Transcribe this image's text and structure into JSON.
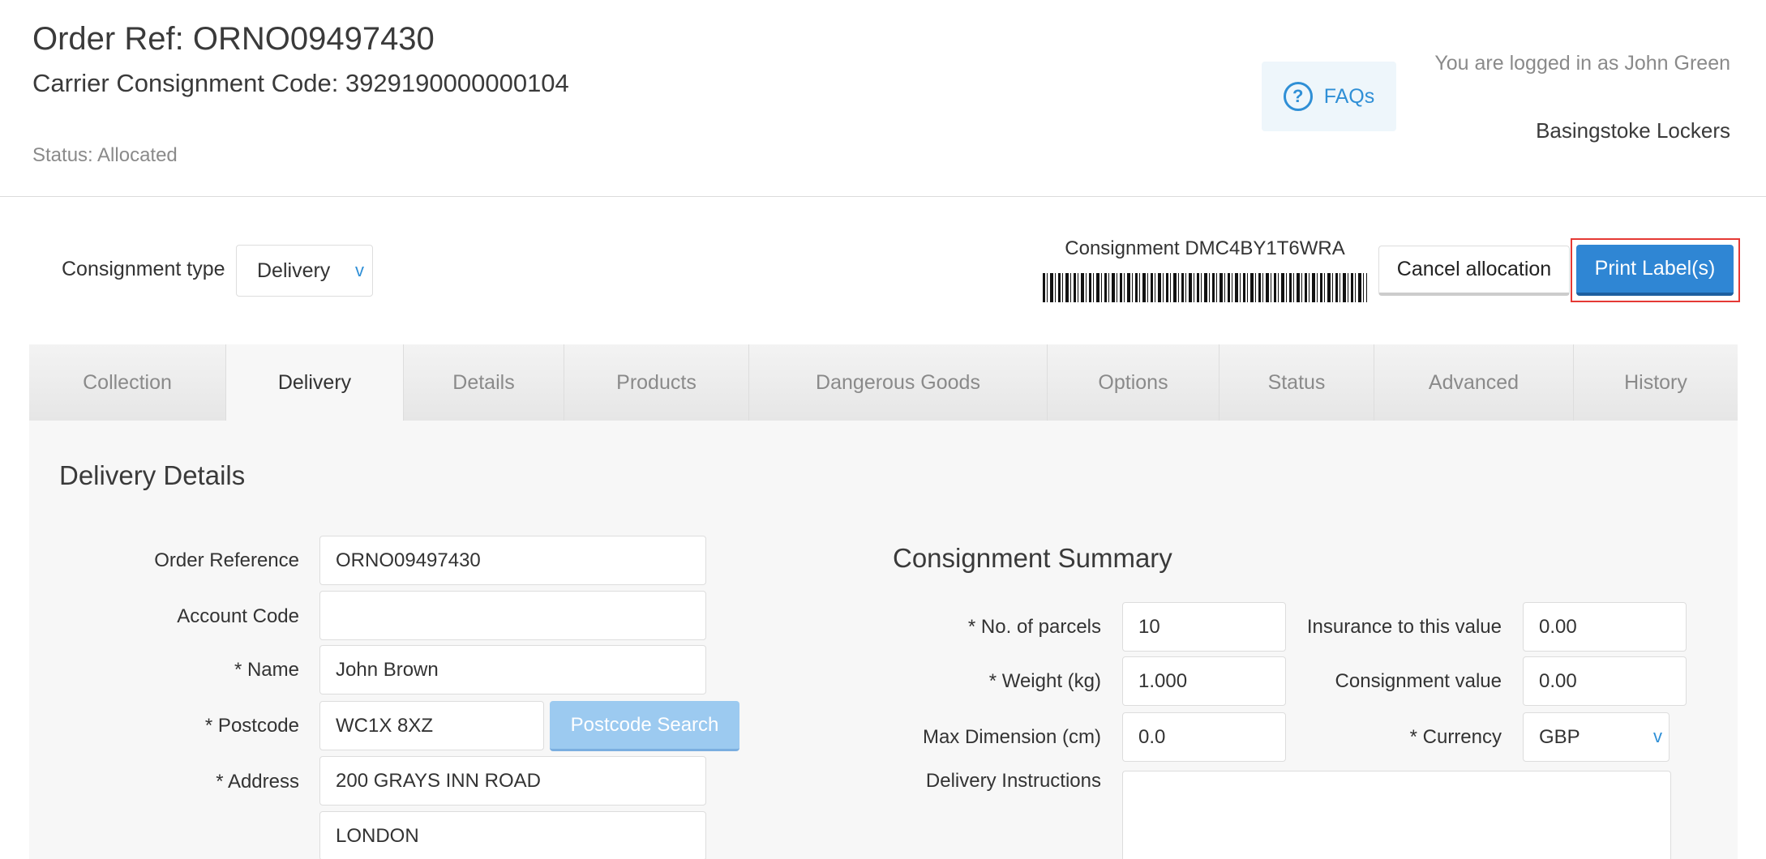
{
  "header": {
    "order_ref": "Order Ref: ORNO09497430",
    "carrier_code": "Carrier Consignment Code: 3929190000000104",
    "status": "Status: Allocated",
    "faq_label": "FAQs",
    "faq_icon": "question-circle-icon",
    "login_text": "You are logged in as John Green",
    "site_name": "Basingstoke Lockers"
  },
  "toolbar": {
    "consignment_type_label": "Consignment type",
    "consignment_type_value": "Delivery",
    "consignment_id": "Consignment DMC4BY1T6WRA",
    "cancel_label": "Cancel allocation",
    "print_label": "Print Label(s)"
  },
  "tabs": [
    {
      "label": "Collection"
    },
    {
      "label": "Delivery"
    },
    {
      "label": "Details"
    },
    {
      "label": "Products"
    },
    {
      "label": "Dangerous Goods"
    },
    {
      "label": "Options"
    },
    {
      "label": "Status"
    },
    {
      "label": "Advanced"
    },
    {
      "label": "History"
    }
  ],
  "active_tab": "Delivery",
  "delivery": {
    "title": "Delivery Details",
    "fields": {
      "order_reference": {
        "label": "Order Reference",
        "value": "ORNO09497430"
      },
      "account_code": {
        "label": "Account Code",
        "value": ""
      },
      "name": {
        "label": "* Name",
        "value": "John Brown"
      },
      "postcode": {
        "label": "* Postcode",
        "value": "WC1X 8XZ"
      },
      "address": {
        "label": "* Address",
        "line1": "200 GRAYS INN ROAD",
        "line2": "LONDON"
      }
    },
    "postcode_search_label": "Postcode Search"
  },
  "summary": {
    "title": "Consignment Summary",
    "parcels": {
      "label": "* No. of parcels",
      "value": "10"
    },
    "weight": {
      "label": "* Weight (kg)",
      "value": "1.000"
    },
    "max_dim": {
      "label": "Max Dimension (cm)",
      "value": "0.0"
    },
    "insurance": {
      "label": "Insurance to this value",
      "value": "0.00"
    },
    "cons_value": {
      "label": "Consignment value",
      "value": "0.00"
    },
    "currency": {
      "label": "* Currency",
      "value": "GBP"
    },
    "instructions": {
      "label": "Delivery Instructions",
      "value": ""
    }
  },
  "colors": {
    "accent": "#2f86d4",
    "highlight": "#e53935"
  }
}
